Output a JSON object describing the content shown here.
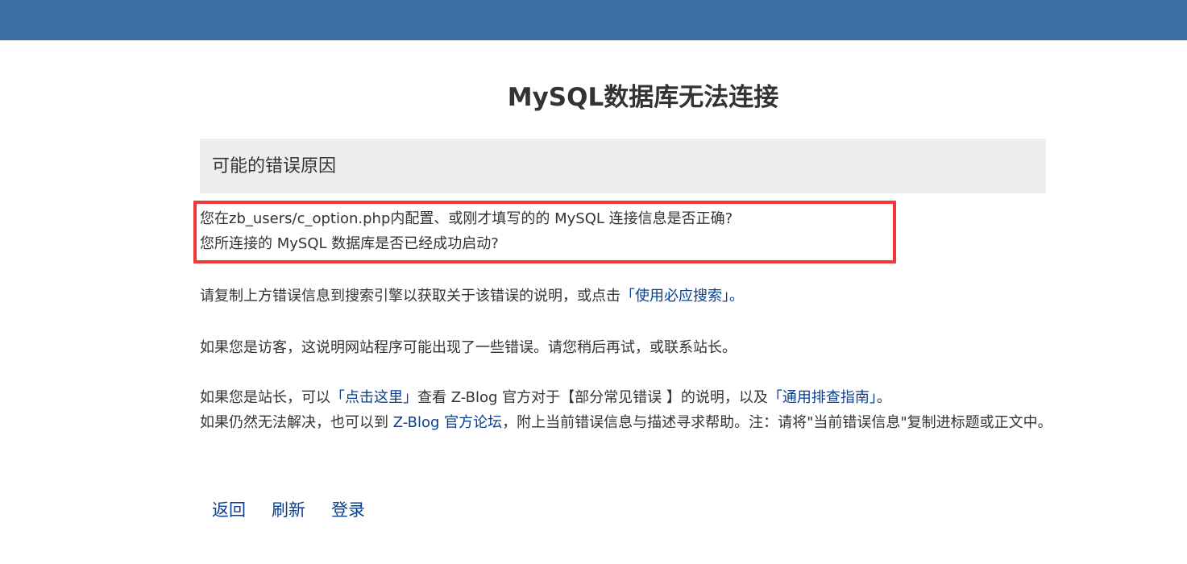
{
  "header": {
    "title": "MySQL数据库无法连接"
  },
  "reasons": {
    "heading": "可能的错误原因",
    "line1": "您在zb_users/c_option.php内配置、或刚才填写的的 MySQL 连接信息是否正确?",
    "line2": "您所连接的 MySQL 数据库是否已经成功启动?"
  },
  "para1": {
    "text": "请复制上方错误信息到搜索引擎以获取关于该错误的说明，或点击",
    "link": "「使用必应搜索」",
    "end": "。"
  },
  "para2": {
    "text": "如果您是访客，这说明网站程序可能出现了一些错误。请您稍后再试，或联系站长。"
  },
  "para3": {
    "t1": "如果您是站长，可以",
    "link1": "「点击这里」",
    "t2": "查看 Z-Blog 官方对于【部分常见错误 】的说明，以及",
    "link2": "「通用排查指南」",
    "t3": "。",
    "t4": "如果仍然无法解决，也可以到 ",
    "link3": "Z-Blog 官方论坛",
    "t5": "，附上当前错误信息与描述寻求帮助。注：请将\"当前错误信息\"复制进标题或正文中。"
  },
  "actions": {
    "back": "返回",
    "refresh": "刷新",
    "login": "登录"
  },
  "colors": {
    "topbar": "#3d6fa5",
    "link": "#0a3f8e",
    "highlight_border": "#f03a3a",
    "section_bg": "#eeeeee"
  }
}
